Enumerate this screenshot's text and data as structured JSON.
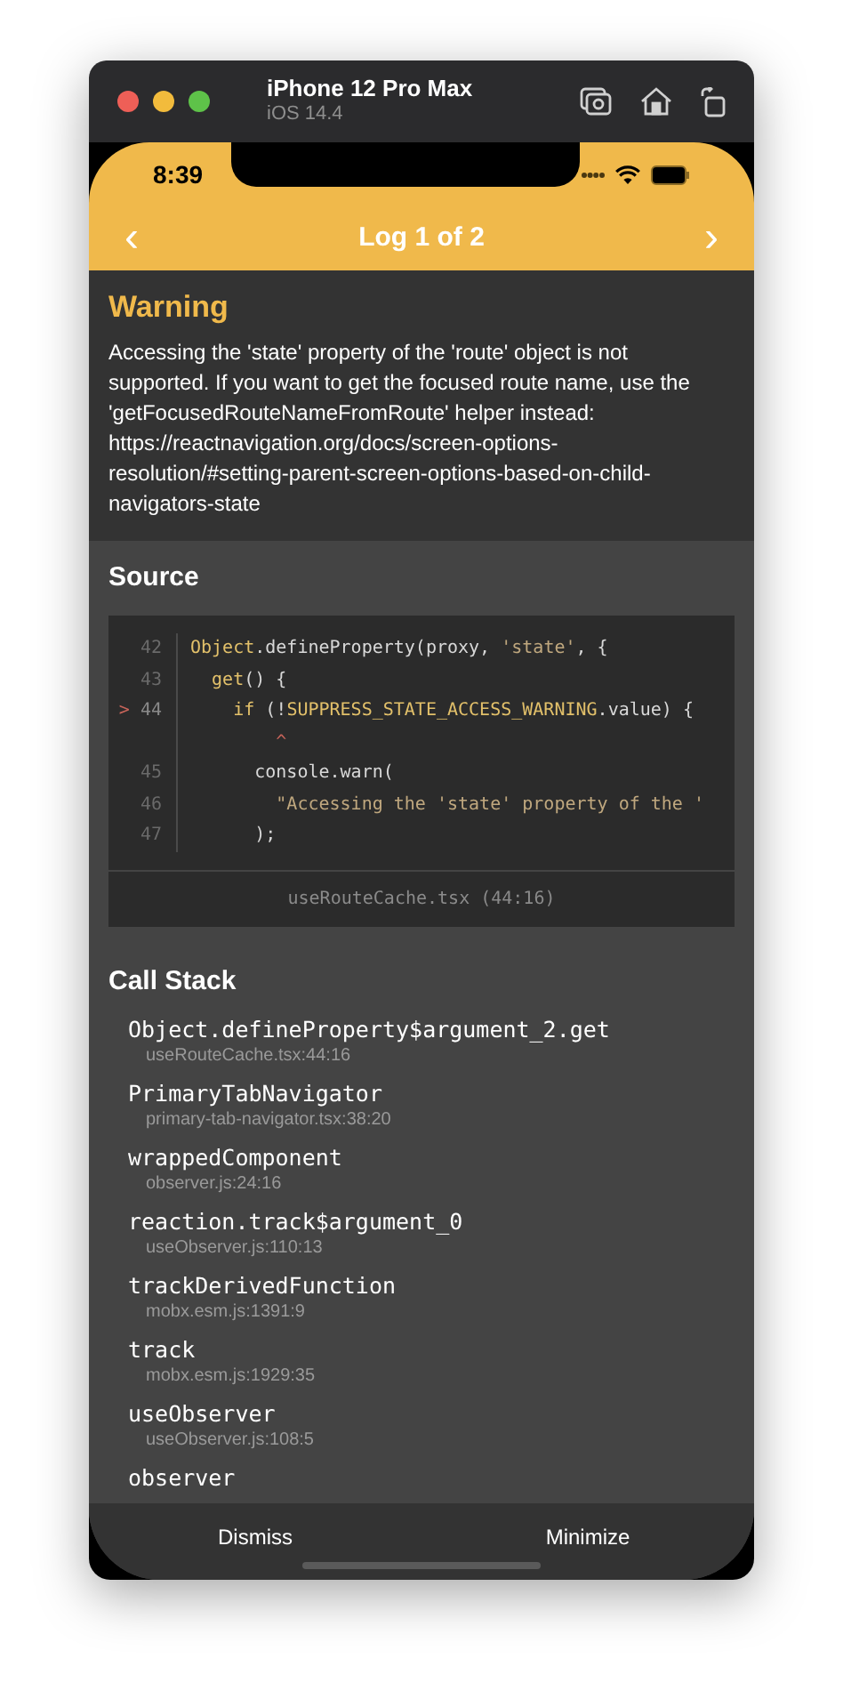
{
  "window": {
    "device": "iPhone 12 Pro Max",
    "os": "iOS 14.4"
  },
  "status_bar": {
    "time": "8:39"
  },
  "nav": {
    "prev": "‹",
    "title": "Log 1 of 2",
    "next": "›"
  },
  "warning": {
    "title": "Warning",
    "message": "Accessing the 'state' property of the 'route' object is not supported. If you want to get the focused route name, use the 'getFocusedRouteNameFromRoute' helper instead: https://reactnavigation.org/docs/screen-options-resolution/#setting-parent-screen-options-based-on-child-navigators-state"
  },
  "source": {
    "title": "Source",
    "file": "useRouteCache.tsx (44:16)",
    "lines": [
      {
        "kind": "code",
        "number": "42",
        "current": false,
        "tokens": [
          {
            "text": "Object",
            "kind": "ident"
          },
          {
            "text": ".defineProperty(proxy, ",
            "kind": "plain"
          },
          {
            "text": "'state'",
            "kind": "string"
          },
          {
            "text": ", {",
            "kind": "plain"
          }
        ]
      },
      {
        "kind": "code",
        "number": "43",
        "current": false,
        "tokens": [
          {
            "text": "  get",
            "kind": "ident"
          },
          {
            "text": "() {",
            "kind": "plain"
          }
        ]
      },
      {
        "kind": "code",
        "number": "44",
        "current": true,
        "marker": ">",
        "tokens": [
          {
            "text": "    if",
            "kind": "ident"
          },
          {
            "text": " (!",
            "kind": "plain"
          },
          {
            "text": "SUPPRESS_STATE_ACCESS_WARNING",
            "kind": "ident"
          },
          {
            "text": ".value) {",
            "kind": "plain"
          }
        ]
      },
      {
        "kind": "caret",
        "tokens": [
          {
            "text": "        ^",
            "kind": "error"
          }
        ]
      },
      {
        "kind": "code",
        "number": "45",
        "current": false,
        "tokens": [
          {
            "text": "      console.warn(",
            "kind": "plain"
          }
        ]
      },
      {
        "kind": "code",
        "number": "46",
        "current": false,
        "tokens": [
          {
            "text": "        \"Accessing the 'state' property of the '",
            "kind": "string"
          }
        ]
      },
      {
        "kind": "code",
        "number": "47",
        "current": false,
        "tokens": [
          {
            "text": "      );",
            "kind": "plain"
          }
        ]
      }
    ]
  },
  "call_stack": {
    "title": "Call Stack",
    "frames": [
      {
        "name": "Object.defineProperty$argument_2.get",
        "location": "useRouteCache.tsx:44:16"
      },
      {
        "name": "PrimaryTabNavigator",
        "location": "primary-tab-navigator.tsx:38:20"
      },
      {
        "name": "wrappedComponent",
        "location": "observer.js:24:16"
      },
      {
        "name": "reaction.track$argument_0",
        "location": "useObserver.js:110:13"
      },
      {
        "name": "trackDerivedFunction",
        "location": "mobx.esm.js:1391:9"
      },
      {
        "name": "track",
        "location": "mobx.esm.js:1929:35"
      },
      {
        "name": "useObserver",
        "location": "useObserver.js:108:5"
      },
      {
        "name": "observer"
      }
    ]
  },
  "buttons": [
    "Dismiss",
    "Minimize"
  ]
}
